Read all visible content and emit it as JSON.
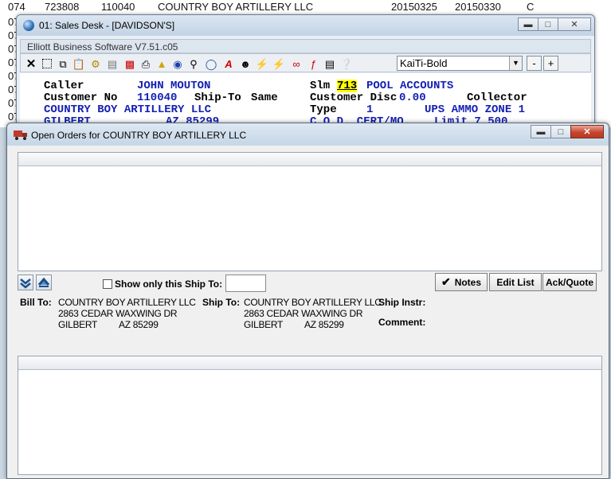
{
  "background_list": {
    "rows": [
      {
        "c1": "074",
        "c2": "723808",
        "c3": "110040",
        "c4": "COUNTRY BOY ARTILLERY LLC",
        "c5": "20150325",
        "c6": "20150330",
        "c7": "C"
      },
      {
        "c1": "07"
      },
      {
        "c1": "07"
      },
      {
        "c1": "07"
      },
      {
        "c1": "07"
      },
      {
        "c1": "07"
      },
      {
        "c1": "07"
      },
      {
        "c1": "07"
      },
      {
        "c1": "07"
      }
    ]
  },
  "sales_desk": {
    "window_title": "01: Sales Desk - [DAVIDSON'S]",
    "subheader": "Elliott Business Software V7.51.c05",
    "toolbar": {
      "font_value": "KaiTi-Bold",
      "minus_label": "-",
      "plus_label": "+",
      "icons": [
        "close-x-icon",
        "select-rect-icon",
        "copy-icon",
        "paste-icon",
        "gear-icon",
        "properties-icon",
        "database-icon",
        "print-icon",
        "bell-icon",
        "binoculars-icon",
        "magnifier-icon",
        "globe-icon",
        "red-a-icon",
        "person-icon",
        "lightning-icon",
        "lightning-box-icon",
        "link-icon",
        "function-icon",
        "notepad-icon",
        "help-pointer-icon"
      ]
    },
    "fields": {
      "caller_label": "Caller",
      "caller_value": "JOHN MOUTON",
      "slm_label": "Slm",
      "slm_value": "713",
      "slm_desc": "POOL ACCOUNTS",
      "customer_no_label": "Customer No",
      "customer_no_value": "110040",
      "shipto_label": "Ship-To",
      "shipto_value": "Same",
      "cust_disc_label": "Customer Disc",
      "cust_disc_value": "0.00",
      "collector_label": "Collector",
      "customer_name": "COUNTRY BOY ARTILLERY LLC",
      "type_label": "Type",
      "type_value": "1",
      "ups_zone": "UPS AMMO ZONE 1",
      "city_partial": "GILBERT",
      "state_zip_partial": "AZ 85299",
      "cod_text": "C.O.D. CERT/MO.",
      "limit_text": "Limit 7,500"
    }
  },
  "open_orders": {
    "window_title": "Open Orders for COUNTRY BOY ARTILLERY LLC",
    "show_only_label": "Show only this Ship To:",
    "ship_to_filter_value": "",
    "buttons": {
      "notes": "Notes",
      "edit_list": "Edit List",
      "ack_quote": "Ack/Quote"
    },
    "bill_to": {
      "label": "Bill To:",
      "name": "COUNTRY BOY ARTILLERY LLC",
      "address": "2863 CEDAR WAXWING DR",
      "city": "GILBERT",
      "state_zip": "AZ 85299"
    },
    "ship_to": {
      "label": "Ship To:",
      "name": "COUNTRY BOY ARTILLERY LLC",
      "address": "2863 CEDAR WAXWING DR",
      "city": "GILBERT",
      "state_zip": "AZ 85299"
    },
    "ship_instr_label": "Ship Instr:",
    "comment_label": "Comment:"
  },
  "colors": {
    "accent_blue": "#1420b4",
    "highlight_yellow": "#ffff00",
    "close_red": "#c7452f"
  }
}
